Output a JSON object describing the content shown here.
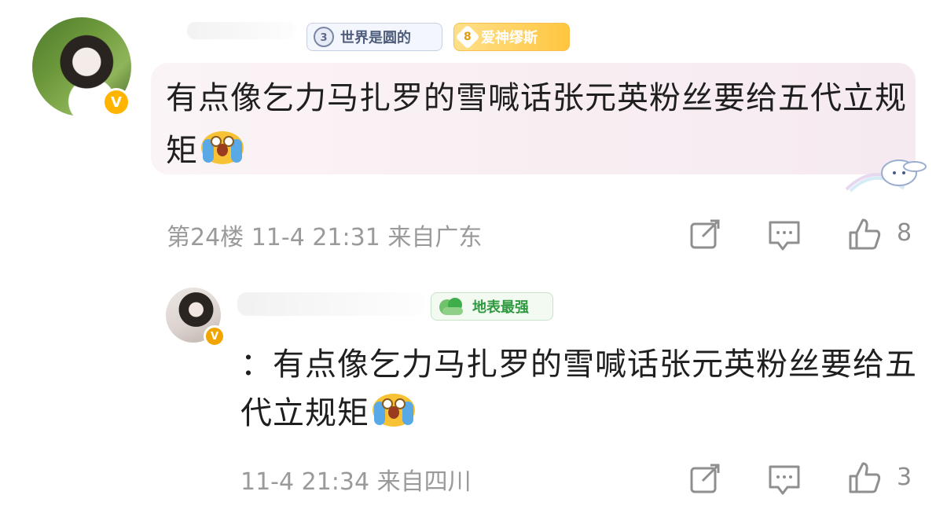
{
  "comment": {
    "tags": {
      "world_label": "世界是圆的",
      "love_level": "8",
      "love_label": "爱神缪斯"
    },
    "verified_badge": "V",
    "text": "有点像乞力马扎罗的雪喊话张元英粉丝要给五代立规矩",
    "emoji": "crying-face",
    "meta": "第24楼 11-4 21:31 来自广东",
    "likes": "8"
  },
  "reply": {
    "tag_label": "地表最强",
    "verified_badge": "V",
    "text": "：有点像乞力马扎罗的雪喊话张元英粉丝要给五代立规矩",
    "emoji": "crying-face",
    "meta": "11-4 21:34 来自四川",
    "likes": "3"
  },
  "colors": {
    "badge_gold": "#ffb400",
    "meta_gray": "#9a9a9a",
    "bubble_pink": "#f8eef2",
    "tag_green": "#2f9a40"
  },
  "icons": {
    "share": "share-icon",
    "comment": "comment-icon",
    "like": "thumbs-up-icon",
    "emoji": "crying-emoji-icon",
    "world": "globe-badge-icon",
    "earth": "cloud-badge-icon",
    "decoration": "cinnamoroll-icon"
  }
}
